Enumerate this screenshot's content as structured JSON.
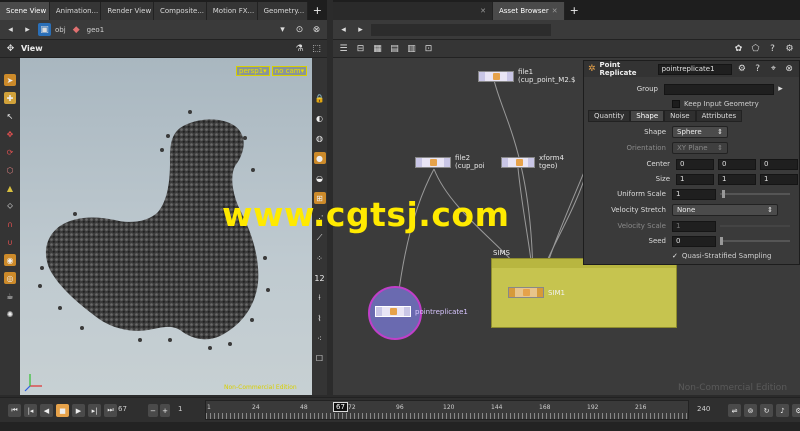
{
  "left_tabs": [
    "Scene View",
    "Animation...",
    "Render View",
    "Composite...",
    "Motion FX...",
    "Geometry..."
  ],
  "right_tabs": [
    "Asset Browser"
  ],
  "path_bar": {
    "level1": "obj",
    "level2": "geo1"
  },
  "viewport": {
    "title": "View",
    "camera_persp": "persp1▾",
    "camera_cam": "no cam▾",
    "edition": "Non-Commercial Edition"
  },
  "network": {
    "nodes": [
      {
        "name": "file1",
        "sub": "(cup_point_M2.$"
      },
      {
        "name": "file2",
        "sub": "(cup_poi"
      },
      {
        "name": "xform4",
        "sub": "tgeo)"
      },
      {
        "name": "pointreplicate1",
        "sub": ""
      },
      {
        "name": "SIM1",
        "sub": ""
      }
    ],
    "box_label": "SIMS",
    "edition": "Non-Commercial Edition"
  },
  "params": {
    "node_type": "Point Replicate",
    "node_name": "pointreplicate1",
    "group_label": "Group",
    "keep_input": "Keep Input Geometry",
    "tabs": [
      "Quantity",
      "Shape",
      "Noise",
      "Attributes"
    ],
    "shape_label": "Shape",
    "shape_value": "Sphere",
    "orientation_label": "Orientation",
    "orientation_value": "XY Plane",
    "center_label": "Center",
    "center": [
      "0",
      "0",
      "0"
    ],
    "size_label": "Size",
    "size": [
      "1",
      "1",
      "1"
    ],
    "uniform_scale_label": "Uniform Scale",
    "uniform_scale": "1",
    "velocity_stretch_label": "Velocity Stretch",
    "velocity_stretch": "None",
    "velocity_scale_label": "Velocity Scale",
    "velocity_scale": "1",
    "seed_label": "Seed",
    "seed": "0",
    "quasi_label": "Quasi-Stratified Sampling"
  },
  "timeline": {
    "frame": "67",
    "start": "1",
    "end": "240",
    "current_marker": "67",
    "ticks": [
      "1",
      "24",
      "48",
      "72",
      "96",
      "120",
      "144",
      "168",
      "192",
      "216"
    ]
  },
  "watermark": "www.cgtsj.com",
  "colors": {
    "sim_box": "#c6c44f",
    "node_selected": "#c03fc9",
    "accent_yellow": "#ffea00"
  }
}
